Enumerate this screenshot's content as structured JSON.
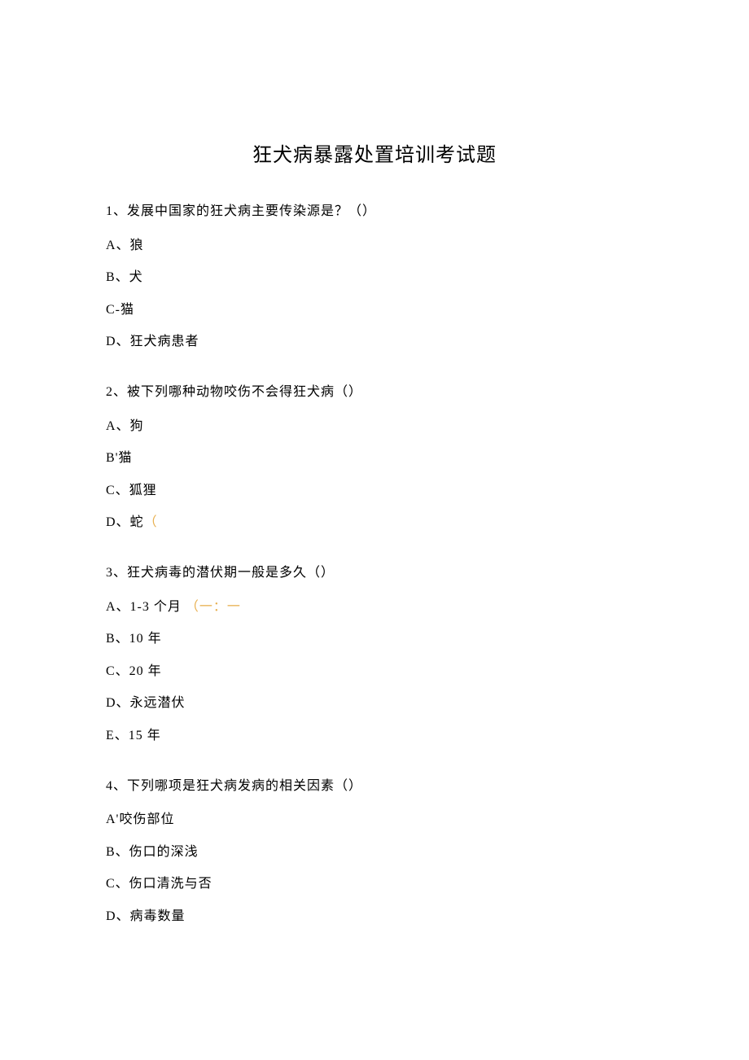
{
  "title": "狂犬病暴露处置培训考试题",
  "questions": [
    {
      "prompt": "1、发展中国家的狂犬病主要传染源是？（）",
      "options": [
        {
          "text": "A、狼",
          "highlight": null
        },
        {
          "text": "B、犬",
          "highlight": null
        },
        {
          "text": "C-猫",
          "highlight": null
        },
        {
          "text": "D、狂犬病患者",
          "highlight": null
        }
      ]
    },
    {
      "prompt": "2、被下列哪种动物咬伤不会得狂犬病（）",
      "options": [
        {
          "text": "A、狗",
          "highlight": null
        },
        {
          "text": "B'猫",
          "highlight": null
        },
        {
          "text": "C、狐狸",
          "highlight": null
        },
        {
          "text": "D、蛇",
          "highlight": "（"
        }
      ]
    },
    {
      "prompt": "3、狂犬病毒的潜伏期一般是多久（）",
      "options": [
        {
          "text": "A、1-3 个月",
          "highlight": "（一：一"
        },
        {
          "text": "B、10 年",
          "highlight": null
        },
        {
          "text": "C、20 年",
          "highlight": null
        },
        {
          "text": "D、永远潜伏",
          "highlight": null
        },
        {
          "text": "E、15 年",
          "highlight": null
        }
      ]
    },
    {
      "prompt": "4、下列哪项是狂犬病发病的相关因素（）",
      "options": [
        {
          "text": "A'咬伤部位",
          "highlight": null
        },
        {
          "text": "B、伤口的深浅",
          "highlight": null
        },
        {
          "text": "C、伤口清洗与否",
          "highlight": null
        },
        {
          "text": "D、病毒数量",
          "highlight": null
        }
      ]
    }
  ]
}
